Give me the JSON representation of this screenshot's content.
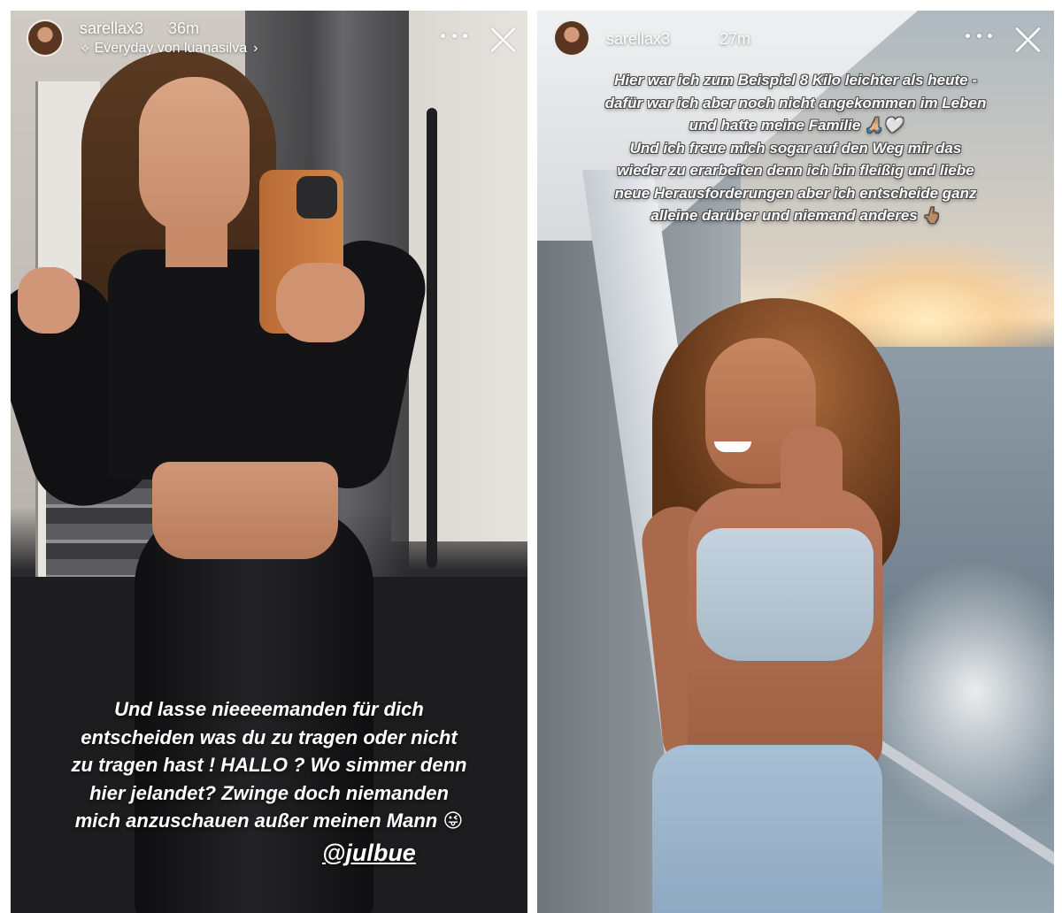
{
  "stories": {
    "left": {
      "username": "sarellax3",
      "time": "36m",
      "music_label": "Everyday von luanasilva",
      "caption_lines": [
        "Und lasse nieeeemanden für dich",
        "entscheiden was du zu tragen oder nicht",
        "zu tragen hast ! HALLO ? Wo simmer denn",
        "hier jelandet? Zwinge doch niemanden",
        "mich anzuschauen außer meinen Mann 😜"
      ],
      "mention": "@julbue"
    },
    "right": {
      "username": "sarellax3",
      "time": "27m",
      "caption_lines": [
        "Hier war ich zum Beispiel 8 Kilo leichter als heute -",
        "dafür war ich aber noch nicht angekommen im Leben",
        "und hatte meine Familie 🙏🏼🤍",
        "Und ich freue mich sogar auf den Weg mir das",
        "wieder zu erarbeiten denn ich bin fleißig und liebe",
        "neue Herausforderungen aber ich entscheide ganz",
        "alleine darüber und niemand anderes 👆🏽"
      ]
    }
  },
  "icons": {
    "more": "more-options-icon",
    "close": "close-icon",
    "music": "sparkle-music-icon",
    "chevron": "chevron-right-icon"
  },
  "colors": {
    "overlay_text": "#ffffff",
    "page_background": "#ffffff"
  }
}
